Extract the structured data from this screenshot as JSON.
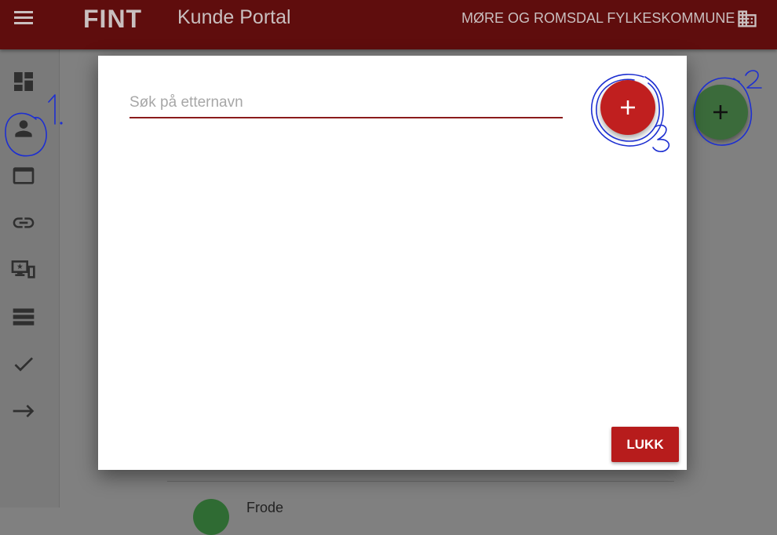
{
  "header": {
    "logo_text": "FINT",
    "title": "Kunde Portal",
    "organization": "MØRE OG ROMSDAL FYLKESKOMMUNE",
    "menu_icon": "hamburger-menu-icon",
    "org_icon": "building-icon"
  },
  "sidebar": {
    "items": [
      {
        "icon": "dashboard-icon"
      },
      {
        "icon": "person-icon"
      },
      {
        "icon": "window-icon"
      },
      {
        "icon": "link-icon"
      },
      {
        "icon": "devices-icon"
      },
      {
        "icon": "list-icon"
      },
      {
        "icon": "check-icon"
      },
      {
        "icon": "arrow-right-icon"
      }
    ]
  },
  "dialog": {
    "search_placeholder": "Søk på etternavn",
    "search_value": "",
    "add_label": "+",
    "close_label": "LUKK"
  },
  "background": {
    "fab_label": "+",
    "list_name_partial": "Frode"
  },
  "annotations": {
    "labels": [
      "1.",
      "2",
      "3"
    ]
  },
  "colors": {
    "header_bg": "#5f0d0d",
    "accent_red": "#b71c1c",
    "fab_green": "#3b6b3b",
    "annotation_blue": "#1d2fd1"
  }
}
